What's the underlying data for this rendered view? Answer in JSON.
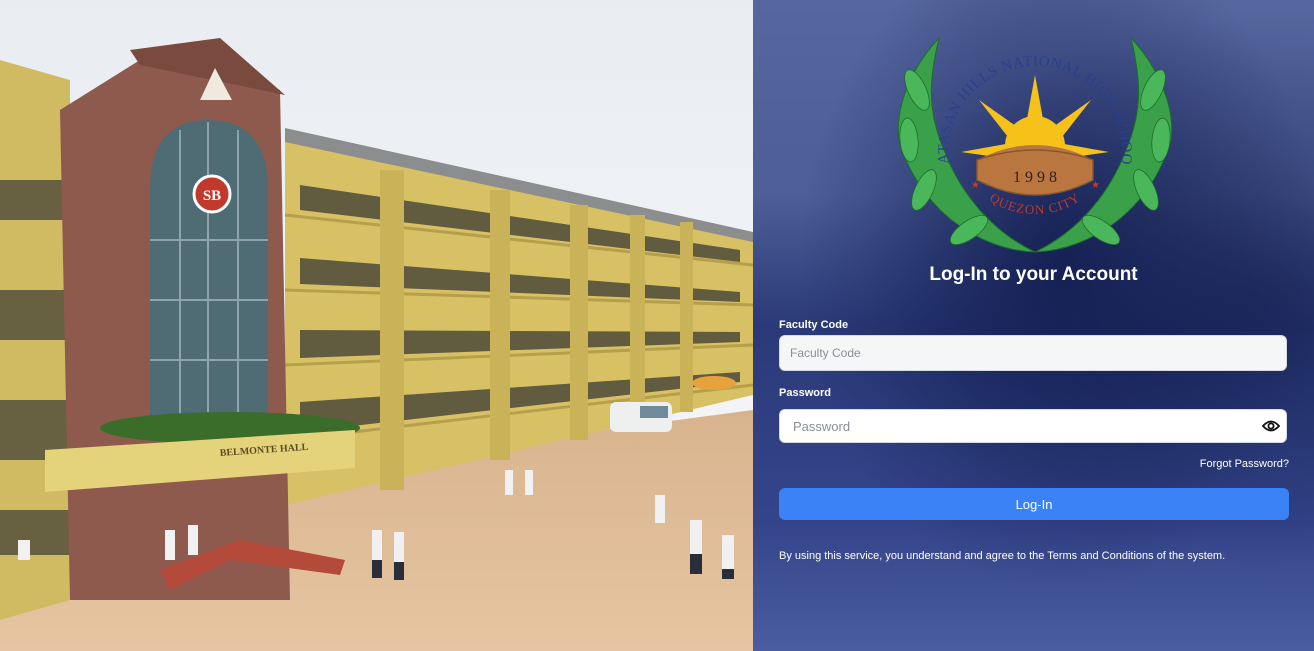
{
  "photo": {
    "sign_text": "BELMONTE HALL",
    "emblem_text": "SB"
  },
  "logo": {
    "arc_text": "BATASAN HILLS NATIONAL HIGH SCHOOL",
    "year": "1 9 9 8",
    "city": "QUEZON CITY",
    "colors": {
      "laurel": "#3aa14a",
      "sun": "#f6c21a",
      "mound": "#b9773f",
      "text": "#2b3f8f",
      "city_text": "#c0392b"
    }
  },
  "login": {
    "title": "Log-In to your Account",
    "faculty_label": "Faculty Code",
    "faculty_placeholder": "Faculty Code",
    "password_label": "Password",
    "password_placeholder": "Password",
    "forgot": "Forgot Password?",
    "submit": "Log-In",
    "terms": "By using this service, you understand and agree to the Terms and Conditions of the system."
  },
  "colors": {
    "button": "#3b82f6"
  }
}
